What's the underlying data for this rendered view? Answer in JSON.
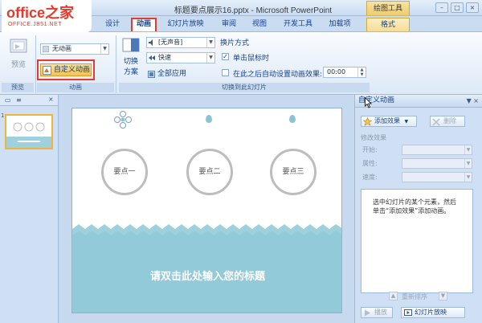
{
  "app": {
    "logo_main": "office之家",
    "logo_sub": "OFFICE.JB51.NET",
    "window_title": "标题要点展示16.pptx - Microsoft PowerPoint",
    "contextual_tab": "绘图工具"
  },
  "tabs": [
    {
      "label": "设计"
    },
    {
      "label": "动画"
    },
    {
      "label": "幻灯片放映"
    },
    {
      "label": "审阅"
    },
    {
      "label": "视图"
    },
    {
      "label": "开发工具"
    },
    {
      "label": "加载项"
    },
    {
      "label": "格式"
    }
  ],
  "ribbon": {
    "preview_label": "预览",
    "preview_group": "预览",
    "no_animation": "无动画",
    "custom_animation": "自定义动画",
    "animation_group": "动画",
    "switch_scheme_1": "切换",
    "switch_scheme_2": "方案",
    "sound_value": "[无声音]",
    "speed_value": "快速",
    "apply_all": "全部应用",
    "advance_title": "换片方式",
    "on_click": "单击鼠标时",
    "after_label": "在此之后自动设置动画效果:",
    "after_time": "00:00",
    "transition_group": "切换到此幻灯片"
  },
  "left_pane": {
    "slide_number": "1"
  },
  "slide": {
    "point_1": "要点一",
    "point_2": "要点二",
    "point_3": "要点三",
    "title_placeholder": "请双击此处输入您的标题",
    "colors": {
      "wave": "#9fd0de",
      "circle_border": "#bdbdbd"
    }
  },
  "task_pane": {
    "title": "自定义动画",
    "add_effect": "添加效果",
    "delete": "删除",
    "modify_label": "修改效果",
    "start_label": "开始:",
    "property_label": "属性:",
    "speed_label": "速度:",
    "hint": "选中幻灯片的某个元素，然后单击“添加效果”添加动画。",
    "reorder": "重新排序",
    "play": "播放",
    "slideshow": "幻灯片放映"
  }
}
